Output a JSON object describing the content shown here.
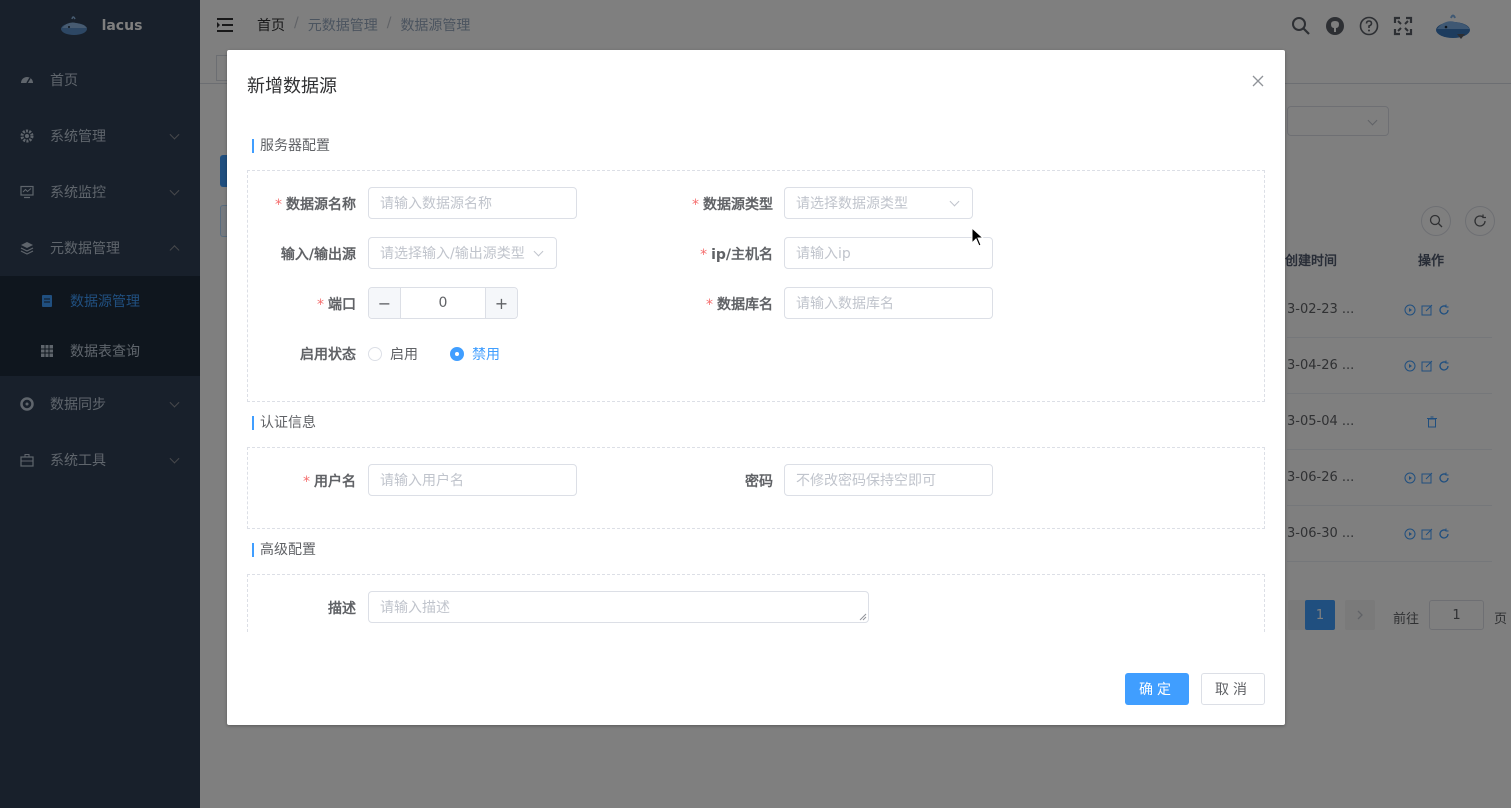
{
  "app": {
    "title": "lacus"
  },
  "sidebar": {
    "items": [
      {
        "label": "首页",
        "icon": "dashboard-icon"
      },
      {
        "label": "系统管理",
        "icon": "gear-icon"
      },
      {
        "label": "系统监控",
        "icon": "monitor-icon"
      },
      {
        "label": "元数据管理",
        "icon": "layers-icon"
      },
      {
        "label": "数据同步",
        "icon": "sync-icon"
      },
      {
        "label": "系统工具",
        "icon": "toolbox-icon"
      }
    ],
    "submenu": [
      {
        "label": "数据源管理",
        "icon": "database-icon",
        "active": true
      },
      {
        "label": "数据表查询",
        "icon": "table-icon"
      }
    ]
  },
  "breadcrumb": {
    "home": "首页",
    "sep": "/",
    "level2": "元数据管理",
    "level3": "数据源管理"
  },
  "background": {
    "columns": {
      "created": "创建时间",
      "ops": "操作"
    },
    "rows": [
      "3-02-23 ...",
      "3-04-26 ...",
      "3-05-04 ...",
      "3-06-26 ...",
      "3-06-30 ..."
    ],
    "pager": {
      "current": "1",
      "goto_label": "前往",
      "goto_value": "1",
      "page_suffix": "页"
    }
  },
  "dialog": {
    "title": "新增数据源",
    "sections": {
      "server": "服务器配置",
      "auth": "认证信息",
      "advanced": "高级配置"
    },
    "fields": {
      "name": {
        "label": "数据源名称",
        "placeholder": "请输入数据源名称"
      },
      "type": {
        "label": "数据源类型",
        "placeholder": "请选择数据源类型"
      },
      "io": {
        "label": "输入/输出源",
        "placeholder": "请选择输入/输出源类型"
      },
      "host": {
        "label": "ip/主机名",
        "placeholder": "请输入ip"
      },
      "port": {
        "label": "端口",
        "value": "0",
        "minus": "−",
        "plus": "+"
      },
      "db": {
        "label": "数据库名",
        "placeholder": "请输入数据库名"
      },
      "status": {
        "label": "启用状态",
        "options": [
          "启用",
          "禁用"
        ],
        "selected": "禁用"
      },
      "username": {
        "label": "用户名",
        "placeholder": "请输入用户名"
      },
      "password": {
        "label": "密码",
        "placeholder": "不修改密码保持空即可"
      },
      "desc": {
        "label": "描述",
        "placeholder": "请输入描述"
      }
    },
    "required_mark": "*",
    "buttons": {
      "ok": "确定",
      "cancel": "取消"
    }
  },
  "colors": {
    "primary": "#409eff",
    "sidebar_bg": "#304156",
    "danger": "#f56c6c"
  }
}
